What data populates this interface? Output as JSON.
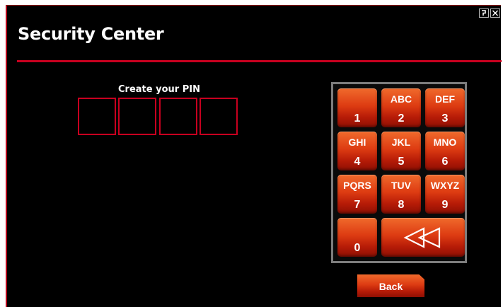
{
  "header": {
    "title": "Security Center"
  },
  "window_controls": {
    "help_icon": "help-icon",
    "close_icon": "close-icon"
  },
  "pin": {
    "label": "Create your PIN",
    "digits": [
      "",
      "",
      "",
      ""
    ]
  },
  "keypad": {
    "keys": [
      {
        "digit": "1",
        "letters": ""
      },
      {
        "digit": "2",
        "letters": "ABC"
      },
      {
        "digit": "3",
        "letters": "DEF"
      },
      {
        "digit": "4",
        "letters": "GHI"
      },
      {
        "digit": "5",
        "letters": "JKL"
      },
      {
        "digit": "6",
        "letters": "MNO"
      },
      {
        "digit": "7",
        "letters": "PQRS"
      },
      {
        "digit": "8",
        "letters": "TUV"
      },
      {
        "digit": "9",
        "letters": "WXYZ"
      },
      {
        "digit": "0",
        "letters": ""
      }
    ],
    "backspace_icon": "double-left-arrow-icon"
  },
  "footer": {
    "back_label": "Back"
  },
  "colors": {
    "background": "#000000",
    "accent": "#c8001f",
    "key": "#dd3b12",
    "keypad_border": "#7d7d7d"
  }
}
